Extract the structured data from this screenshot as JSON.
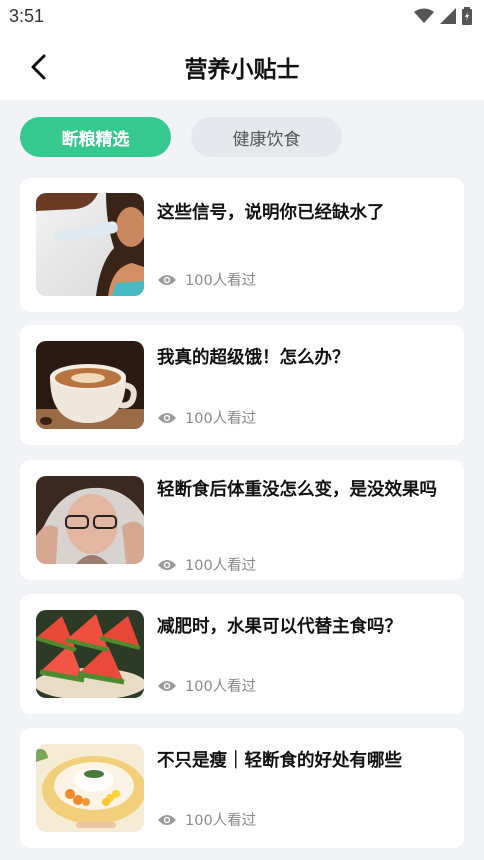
{
  "status_bar": {
    "time": "3:51"
  },
  "header": {
    "title": "营养小贴士"
  },
  "tabs": [
    {
      "label": "断粮精选",
      "active": true
    },
    {
      "label": "健康饮食",
      "active": false
    }
  ],
  "articles": [
    {
      "title": "这些信号，说明你已经缺水了",
      "views": "100人看过",
      "image": "woman-drinking-water"
    },
    {
      "title": "我真的超级饿！怎么办？",
      "views": "100人看过",
      "image": "coffee-cup"
    },
    {
      "title": "轻断食后体重没怎么变，是没效果吗",
      "views": "100人看过",
      "image": "stressed-woman"
    },
    {
      "title": "减肥时，水果可以代替主食吗？",
      "views": "100人看过",
      "image": "watermelon-slices"
    },
    {
      "title": "不只是瘦｜轻断食的好处有哪些",
      "views": "100人看过",
      "image": "rice-plate"
    }
  ],
  "colors": {
    "accent": "#35c98f",
    "background": "#f2f3f7"
  }
}
